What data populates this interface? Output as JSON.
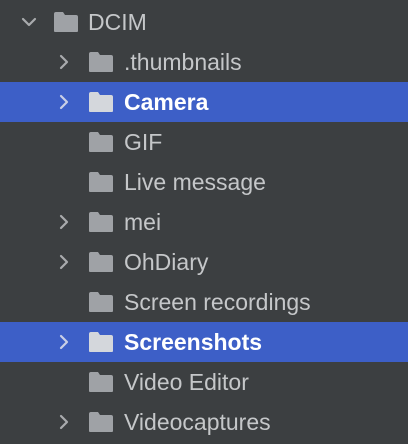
{
  "tree": {
    "root": {
      "label": "DCIM",
      "expanded": true,
      "icon": "folder-icon"
    },
    "items": [
      {
        "label": ".thumbnails",
        "expandable": true,
        "selected": false,
        "icon": "folder-icon"
      },
      {
        "label": "Camera",
        "expandable": true,
        "selected": true,
        "icon": "folder-icon"
      },
      {
        "label": "GIF",
        "expandable": false,
        "selected": false,
        "icon": "folder-icon"
      },
      {
        "label": "Live message",
        "expandable": false,
        "selected": false,
        "icon": "folder-icon"
      },
      {
        "label": "mei",
        "expandable": true,
        "selected": false,
        "icon": "folder-icon"
      },
      {
        "label": "OhDiary",
        "expandable": true,
        "selected": false,
        "icon": "folder-icon"
      },
      {
        "label": "Screen recordings",
        "expandable": false,
        "selected": false,
        "icon": "folder-icon"
      },
      {
        "label": "Screenshots",
        "expandable": true,
        "selected": true,
        "icon": "folder-icon"
      },
      {
        "label": "Video Editor",
        "expandable": false,
        "selected": false,
        "icon": "folder-icon"
      },
      {
        "label": "Videocaptures",
        "expandable": true,
        "selected": false,
        "icon": "folder-icon"
      }
    ]
  },
  "colors": {
    "background": "#3c3f41",
    "selection": "#3d5fc7",
    "text": "#c5c7c9",
    "selected_text": "#ffffff",
    "folder_icon": "#9fa2a6"
  }
}
